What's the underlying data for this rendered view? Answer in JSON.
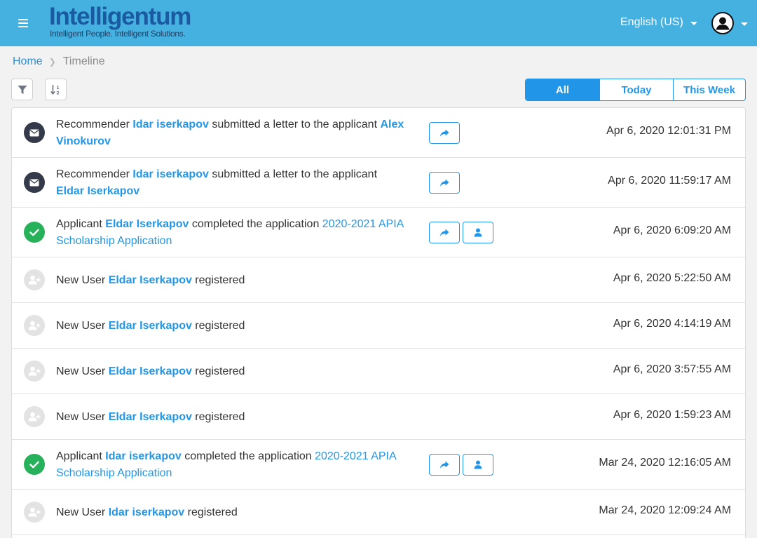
{
  "header": {
    "brand_name": "Intelligentum",
    "brand_tagline": "Intelligent People. Intelligent Solutions.",
    "language": "English (US)",
    "bg_color": "#45b1e1",
    "brand_color": "#1a5aa0"
  },
  "breadcrumb": {
    "home": "Home",
    "current": "Timeline"
  },
  "toolbar": {
    "filter_icon": "filter-icon",
    "sort_icon": "sort-icon"
  },
  "range_filter": {
    "all": "All",
    "today": "Today",
    "this_week": "This Week",
    "selected": "All",
    "accent_color": "#2196e8"
  },
  "events": [
    {
      "icon": "envelope-icon",
      "t1": "Recommender ",
      "l1": "Idar iserkapov",
      "t2": " submitted a letter to the applicant ",
      "l2": "Alex Vinokurov",
      "time": "Apr 6, 2020 12:01:31 PM"
    },
    {
      "icon": "envelope-icon",
      "t1": "Recommender ",
      "l1": "Idar iserkapov",
      "t2": " submitted a letter to the applicant ",
      "l2": "Eldar Iserkapov",
      "time": "Apr 6, 2020 11:59:17 AM"
    },
    {
      "icon": "check-circle-icon",
      "t1": "Applicant ",
      "l1": "Eldar Iserkapov",
      "t2": " completed the application ",
      "l2": "2020-2021 APIA Scholarship Application",
      "time": "Apr 6, 2020 6:09:20 AM"
    },
    {
      "icon": "user-plus-icon",
      "t1": "New User ",
      "l1": "Eldar Iserkapov",
      "t2": " registered",
      "time": "Apr 6, 2020 5:22:50 AM"
    },
    {
      "icon": "user-plus-icon",
      "t1": "New User ",
      "l1": "Eldar Iserkapov",
      "t2": " registered",
      "time": "Apr 6, 2020 4:14:19 AM"
    },
    {
      "icon": "user-plus-icon",
      "t1": "New User ",
      "l1": "Eldar Iserkapov",
      "t2": " registered",
      "time": "Apr 6, 2020 3:57:55 AM"
    },
    {
      "icon": "user-plus-icon",
      "t1": "New User ",
      "l1": "Eldar Iserkapov",
      "t2": " registered",
      "time": "Apr 6, 2020 1:59:23 AM"
    },
    {
      "icon": "check-circle-icon",
      "t1": "Applicant ",
      "l1": "Idar iserkapov",
      "t2": " completed the application ",
      "l2": "2020-2021 APIA Scholarship Application",
      "time": "Mar 24, 2020 12:16:05 AM"
    },
    {
      "icon": "user-plus-icon",
      "t1": "New User ",
      "l1": "Idar iserkapov",
      "t2": " registered",
      "time": "Mar 24, 2020 12:09:24 AM"
    }
  ],
  "colors": {
    "link": "#2396e6",
    "success": "#27b15a",
    "mail_icon_bg": "#343a4a",
    "user_icon_bg": "#e3e3e3"
  }
}
